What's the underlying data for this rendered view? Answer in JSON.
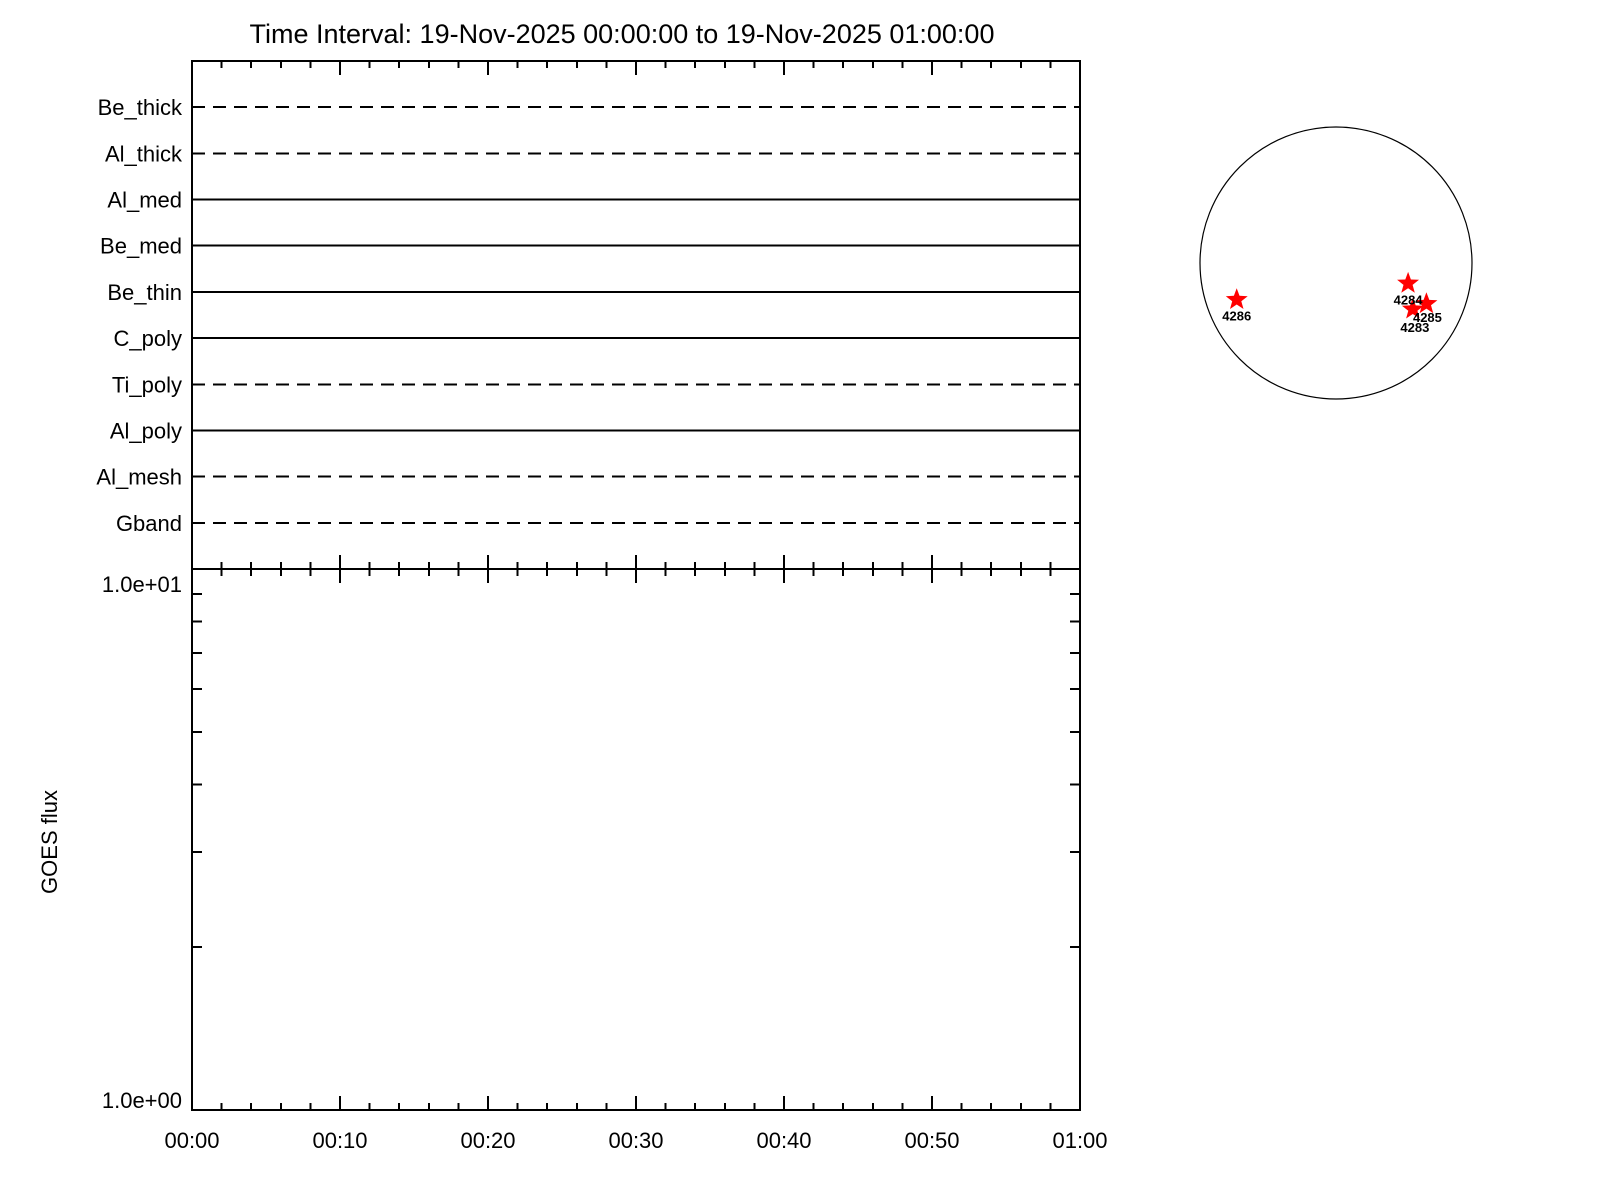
{
  "title": "Time Interval: 19-Nov-2025 00:00:00 to 19-Nov-2025 01:00:00",
  "colors": {
    "foreground": "#000000",
    "background": "#ffffff",
    "active_region_marker": "#ff0000"
  },
  "chart_data": [
    {
      "type": "line",
      "name": "xrt-filter-timeline",
      "description": "Horizontal timeline per XRT filter; dashed or solid full-width line for each filter over the hour",
      "x_axis": {
        "range": [
          "00:00",
          "01:00"
        ],
        "major_tick_labels": [
          "00:00",
          "00:10",
          "00:20",
          "00:30",
          "00:40",
          "00:50",
          "01:00"
        ],
        "minor_ticks_per_major": 5,
        "labels_shown": false
      },
      "rows": [
        {
          "label": "Be_thick",
          "line_style": "dashed"
        },
        {
          "label": "Al_thick",
          "line_style": "dashed"
        },
        {
          "label": "Al_med",
          "line_style": "solid"
        },
        {
          "label": "Be_med",
          "line_style": "solid"
        },
        {
          "label": "Be_thin",
          "line_style": "solid"
        },
        {
          "label": "C_poly",
          "line_style": "solid"
        },
        {
          "label": "Ti_poly",
          "line_style": "dashed"
        },
        {
          "label": "Al_poly",
          "line_style": "solid"
        },
        {
          "label": "Al_mesh",
          "line_style": "dashed"
        },
        {
          "label": "Gband",
          "line_style": "dashed"
        }
      ]
    },
    {
      "type": "line",
      "name": "goes-flux",
      "ylabel": "GOES flux",
      "y_axis": {
        "scale": "log",
        "min": 1,
        "max": 10,
        "tick_labels": [
          "1.0e+00",
          "1.0e+01"
        ],
        "minor_ticks_at": [
          2,
          3,
          4,
          5,
          6,
          7,
          8,
          9
        ]
      },
      "x_axis": {
        "range": [
          "00:00",
          "01:00"
        ],
        "major_tick_labels": [
          "00:00",
          "00:10",
          "00:20",
          "00:30",
          "00:40",
          "00:50",
          "01:00"
        ],
        "minor_ticks_per_major": 5,
        "labels_shown": true
      },
      "series": []
    },
    {
      "type": "scatter",
      "name": "solar-disk-active-regions",
      "marker": "star",
      "marker_color": "#ff0000",
      "regions": [
        {
          "label": "4284",
          "fx": 0.53,
          "fy": 0.15,
          "label_dx": 0,
          "label_dy": 21
        },
        {
          "label": "4283",
          "fx": 0.565,
          "fy": 0.34,
          "label_dx": 2,
          "label_dy": 23
        },
        {
          "label": "4285",
          "fx": 0.665,
          "fy": 0.3,
          "label_dx": 1,
          "label_dy": 18
        },
        {
          "label": "4286",
          "fx": -0.73,
          "fy": 0.27,
          "label_dx": 0,
          "label_dy": 21
        }
      ]
    }
  ]
}
